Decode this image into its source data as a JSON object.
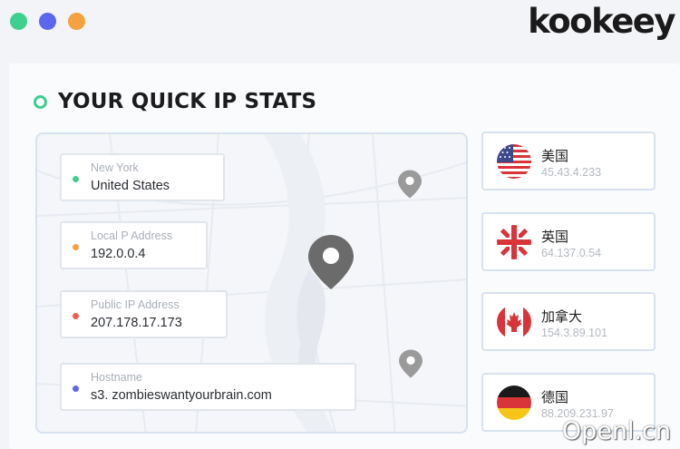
{
  "window": {
    "controls": [
      "close",
      "minimize",
      "maximize"
    ],
    "colors": {
      "close": "#3fcf8e",
      "minimize": "#5a67ee",
      "maximize": "#f5a142"
    }
  },
  "brand": {
    "logo_text": "kookeey"
  },
  "section": {
    "title": "YOUR QUICK IP STATS",
    "accent_color": "#3fcf8e"
  },
  "ip_stats": [
    {
      "label": "New York",
      "value": "United States",
      "dot_color": "#3fcf8e"
    },
    {
      "label": "Local P Address",
      "value": "192.0.0.4",
      "dot_color": "#f5a142"
    },
    {
      "label": "Public IP Address",
      "value": "207.178.17.173",
      "dot_color": "#ef5b4c"
    },
    {
      "label": "Hostname",
      "value": "s3. zombieswantyourbrain.com",
      "dot_color": "#5a67ee"
    }
  ],
  "countries": [
    {
      "name": "美国",
      "ip": "45.43.4.233",
      "flag_icon": "us-flag-icon"
    },
    {
      "name": "英国",
      "ip": "64.137.0.54",
      "flag_icon": "uk-flag-icon"
    },
    {
      "name": "加拿大",
      "ip": "154.3.89.101",
      "flag_icon": "canada-flag-icon"
    },
    {
      "name": "德国",
      "ip": "88.209.231.97",
      "flag_icon": "germany-flag-icon"
    }
  ],
  "watermark": {
    "text": "Openl.cn"
  }
}
